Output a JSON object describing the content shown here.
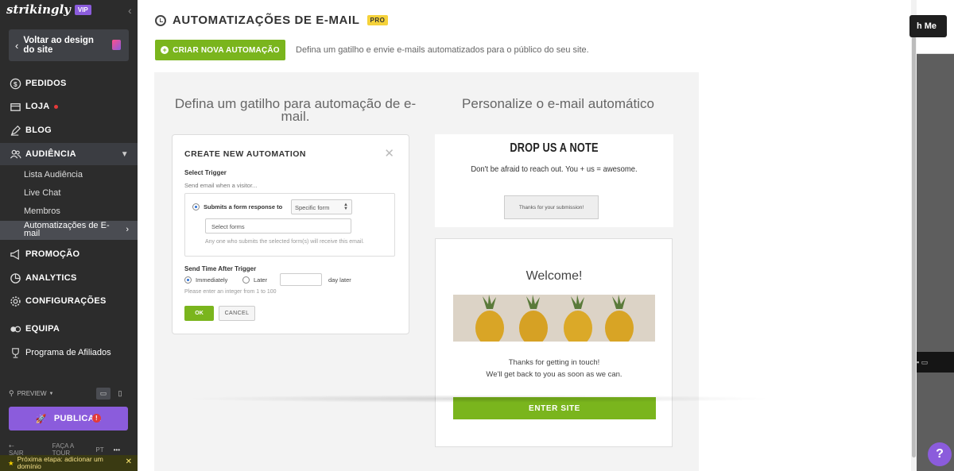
{
  "sidebar": {
    "logo": "strikingly",
    "vip": "VIP",
    "back_label": "Voltar ao design do site",
    "nav": {
      "pedidos": "PEDIDOS",
      "loja": "LOJA",
      "blog": "BLOG",
      "audiencia": "AUDIÊNCIA",
      "promocao": "PROMOÇÃO",
      "analytics": "ANALYTICS",
      "configuracoes": "CONFIGURAÇÕES",
      "equipa": "EQUIPA",
      "afiliados": "Programa de Afiliados"
    },
    "sub": {
      "lista": "Lista Audiência",
      "chat": "Live Chat",
      "membros": "Membros",
      "automacoes": "Automatizações de E-mail"
    },
    "preview": "PREVIEW",
    "publish": "PUBLICAR",
    "publish_warn": "!",
    "bottom": {
      "sair": "SAIR",
      "tour": "FAÇA A TOUR",
      "lang": "PT",
      "more": "•••"
    },
    "next_step": "Próxima etapa: adicionar um domínio"
  },
  "main": {
    "title": "AUTOMATIZAÇÕES DE E-MAIL",
    "pro": "PRO",
    "create_button": "CRIAR NOVA AUTOMAÇÃO",
    "create_desc": "Defina um gatilho e envie e-mails automatizados para o público do seu site.",
    "left_col_title": "Defina um gatilho para automação de e-mail.",
    "right_col_title": "Personalize o e-mail automático"
  },
  "modal": {
    "title": "CREATE NEW AUTOMATION",
    "select_trigger": "Select Trigger",
    "send_when": "Send email when a visitor...",
    "submits_label": "Submits a form response to",
    "specific_form": "Specific form",
    "select_forms_placeholder": "Select forms",
    "hint": "Any one who submits the selected form(s) will receive this email.",
    "send_time": "Send Time After Trigger",
    "immediately": "Immediately",
    "later": "Later",
    "day_later": "day later",
    "integer_hint": "Please enter an integer  from 1 to 100",
    "ok": "OK",
    "cancel": "CANCEL"
  },
  "email_preview": {
    "drop_title": "DROP US A NOTE",
    "drop_sub": "Don't be afraid to reach out. You + us = awesome.",
    "thanks_submission": "Thanks for your submission!",
    "welcome": "Welcome!",
    "thanks_line1": "Thanks for getting in touch!",
    "thanks_line2": "We'll get back to you as soon as we can.",
    "enter_site": "ENTER SITE"
  },
  "background_page": {
    "button_text": "h Me",
    "help": "?"
  },
  "colors": {
    "accent_green": "#7ab51d",
    "brand_purple": "#8b5cdc",
    "pro_yellow": "#f5d23a",
    "sidebar_bg": "#2c2c2c"
  }
}
